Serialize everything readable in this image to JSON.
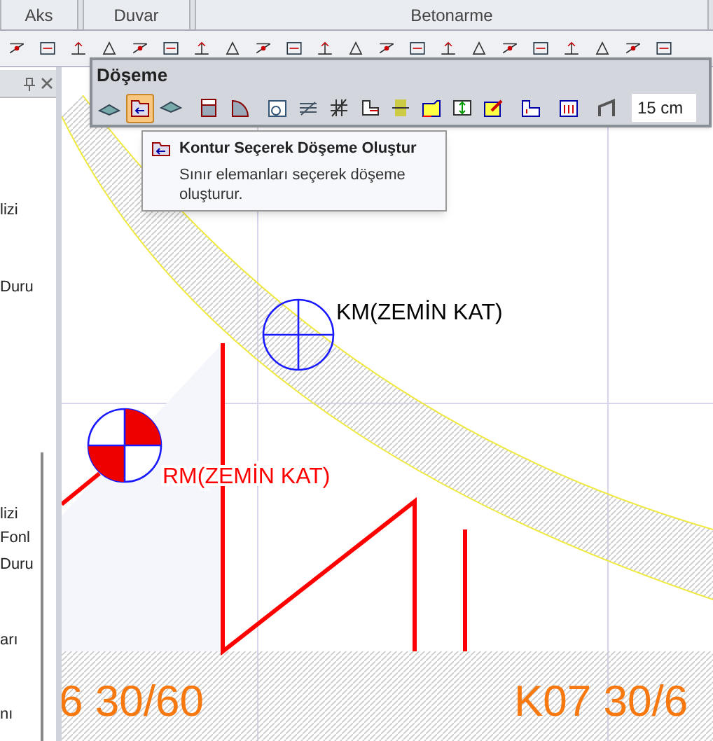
{
  "tabs": [
    {
      "label": "Aks",
      "selected": false
    },
    {
      "label": "Duvar",
      "selected": false
    },
    {
      "label": "Betonarme",
      "selected": false
    }
  ],
  "side_panel": {
    "items": [
      {
        "text": "lizi"
      },
      {
        "text": "Duru"
      },
      {
        "text": "lizi"
      },
      {
        "text": "Fonl"
      },
      {
        "text": "Duru"
      },
      {
        "text": "arı"
      },
      {
        "text": "nı"
      }
    ]
  },
  "floating_toolbar": {
    "title": "Döşeme",
    "tools": [
      {
        "selected": false
      },
      {
        "selected": true
      },
      {
        "selected": false
      },
      {
        "selected": false
      },
      {
        "selected": false
      },
      {
        "selected": false
      },
      {
        "selected": false
      },
      {
        "selected": false
      },
      {
        "selected": false
      },
      {
        "selected": false
      },
      {
        "selected": false
      },
      {
        "selected": false
      },
      {
        "selected": false
      },
      {
        "selected": false
      },
      {
        "selected": false
      },
      {
        "selected": false
      }
    ],
    "thickness": "15 cm"
  },
  "tooltip": {
    "title": "Kontur Seçerek Döşeme Oluştur",
    "text": "Sınır elemanları seçerek döşeme oluşturur."
  },
  "canvas": {
    "labels": [
      {
        "kind": "axis",
        "text": "KM(ZEMİN KAT)"
      },
      {
        "kind": "reference",
        "text": "RM(ZEMİN KAT)"
      }
    ],
    "beam_labels": [
      "6 30/60",
      "K07 30/6"
    ]
  }
}
